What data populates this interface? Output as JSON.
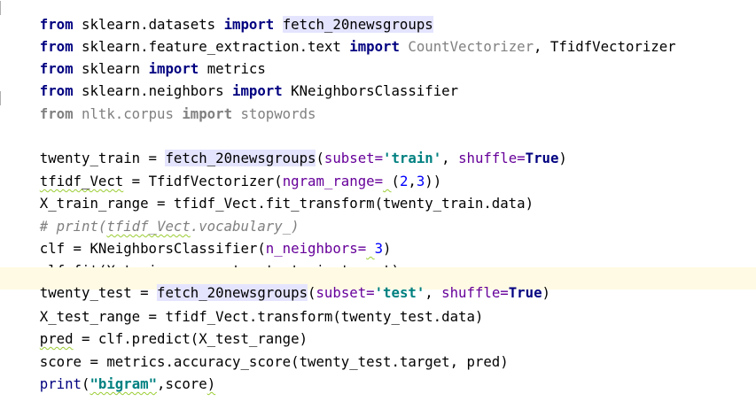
{
  "editor": {
    "lines": [
      {
        "t1": "from",
        "t2": " sklearn.datasets ",
        "t3": "import",
        "t4": " ",
        "t5": "fetch_20newsgroups"
      },
      {
        "t1": "from",
        "t2": " sklearn.feature_extraction.text ",
        "t3": "import",
        "t4": " ",
        "t5": "CountVectorizer",
        "t6": ", TfidfVectorizer"
      },
      {
        "t1": "from",
        "t2": " sklearn ",
        "t3": "import",
        "t4": " metrics"
      },
      {
        "t1": "from",
        "t2": " sklearn.neighbors ",
        "t3": "import",
        "t4": " KNeighborsClassifier"
      },
      {
        "t1": "from",
        "t2": " nltk.corpus ",
        "t3": "import",
        "t4": " stopwords"
      },
      {
        "t1": ""
      },
      {
        "t1": "twenty_train = ",
        "t2": "fetch_20newsgroups",
        "t3": "(",
        "t4": "subset=",
        "t5": "'train'",
        "t6": ", ",
        "t7": "shuffle=",
        "t8": "True",
        "t9": ")"
      },
      {
        "t1": "tfidf_Vect",
        "t2": " = TfidfVectorizer(",
        "t3": "ngram_range=",
        "t4": " ",
        "t5": "(",
        "t6": "2",
        "t7": ",",
        "t8": "3",
        "t9": "))"
      },
      {
        "t1": "X_train_range = tfidf_Vect.fit_transform(twenty_train.data)"
      },
      {
        "t1": "# print(",
        "t2": "tfidf_Vect",
        "t3": ".vocabulary_)"
      },
      {
        "t1": "clf = KNeighborsClassifier(",
        "t2": "n_neighbors=",
        "t3": " ",
        "t4": "3",
        "t5": ")"
      },
      {
        "t1": "clf.fit(X_train_range, twenty_train.target)"
      },
      {
        "t1": "twenty_test = ",
        "t2": "fetch_20newsgroups",
        "t3": "(",
        "t4": "subset=",
        "t5": "'test'",
        "t6": ", ",
        "t7": "shuffle=",
        "t8": "True",
        "t9": ")"
      },
      {
        "t1": "X_test_range = tfidf_Vect.transform(twenty_test.data)"
      },
      {
        "t1": "pred",
        "t2": " = clf.predict(X_test_range)"
      },
      {
        "t1": "score = metrics.accuracy_score(twenty_test.target, pred)"
      },
      {
        "t1": "print",
        "t2": "(",
        "t3": "\"bigram\"",
        "t4": ",score",
        "t5": ")"
      }
    ]
  }
}
